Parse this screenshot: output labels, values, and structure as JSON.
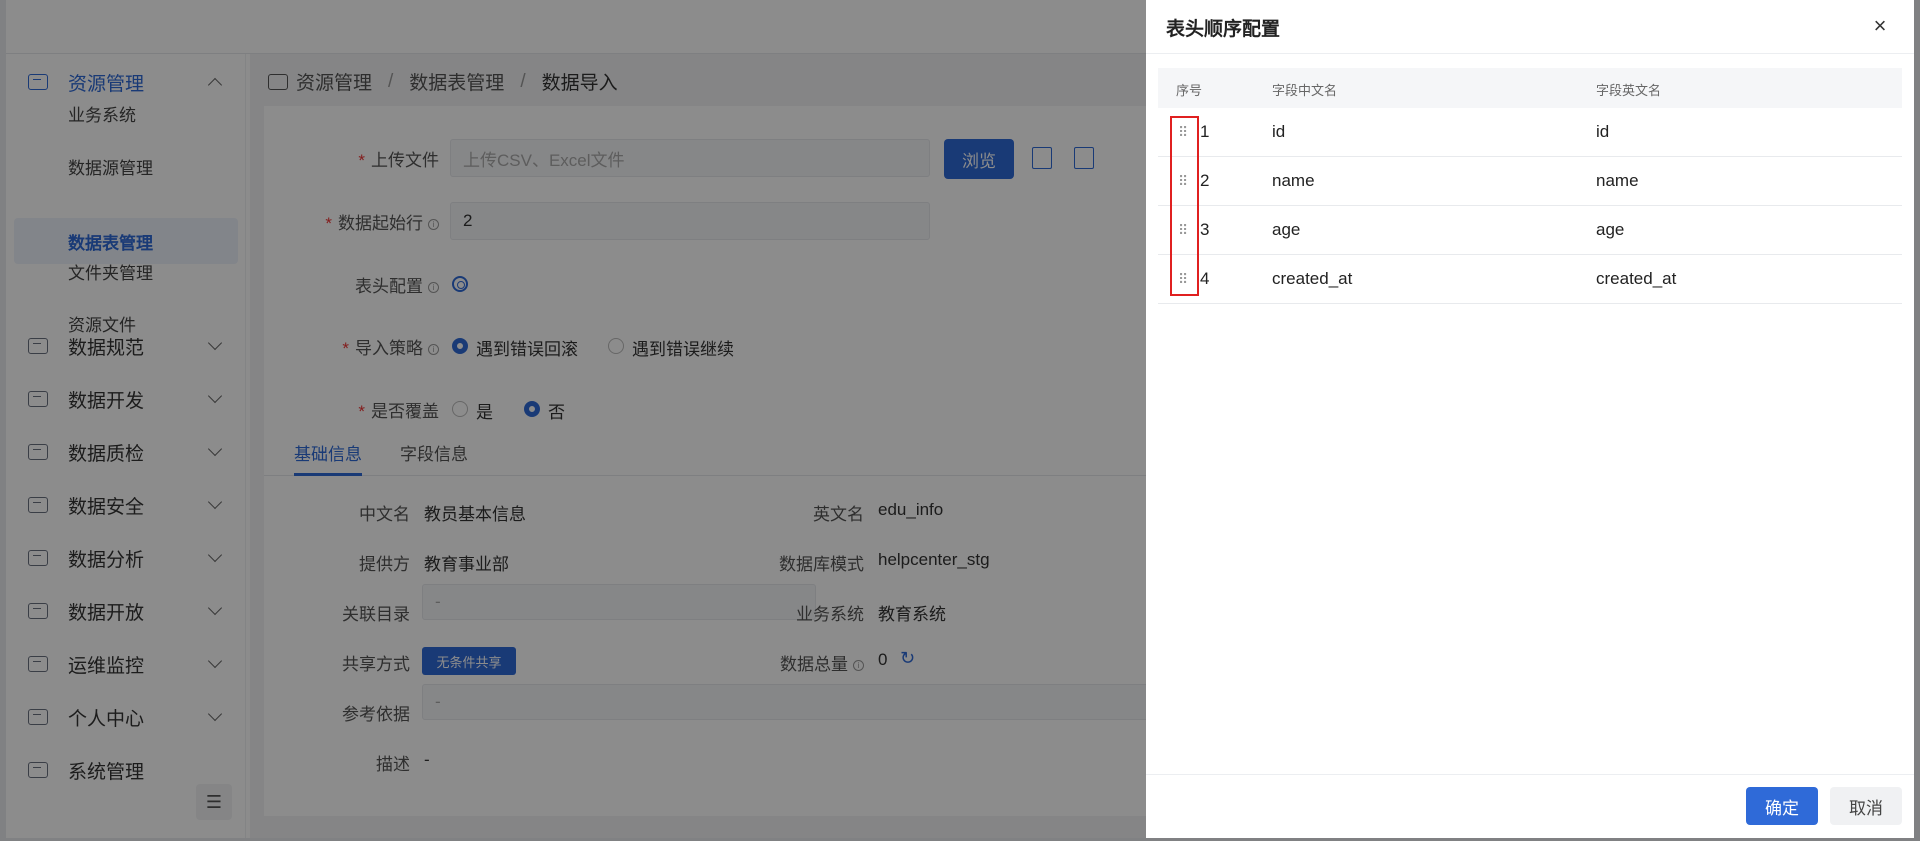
{
  "sidebar": {
    "top": {
      "label": "资源管理",
      "icon": "monitor-icon"
    },
    "sub_items": [
      "业务系统",
      "数据源管理",
      "数据表管理",
      "文件夹管理",
      "资源文件"
    ],
    "active_sub": "数据表管理",
    "menus": [
      {
        "label": "数据规范",
        "icon": "spec-icon"
      },
      {
        "label": "数据开发",
        "icon": "code-icon"
      },
      {
        "label": "数据质检",
        "icon": "quality-icon"
      },
      {
        "label": "数据安全",
        "icon": "security-icon"
      },
      {
        "label": "数据分析",
        "icon": "analysis-icon"
      },
      {
        "label": "数据开放",
        "icon": "open-icon"
      },
      {
        "label": "运维监控",
        "icon": "monitor-chart-icon"
      },
      {
        "label": "个人中心",
        "icon": "user-icon"
      },
      {
        "label": "系统管理",
        "icon": "system-icon"
      }
    ],
    "collapse_icon": "collapse-icon"
  },
  "breadcrumb": {
    "items": [
      "资源管理",
      "数据表管理",
      "数据导入"
    ],
    "separator": "/"
  },
  "form": {
    "upload": {
      "label": "上传文件",
      "placeholder": "上传CSV、Excel文件",
      "browse": "浏览"
    },
    "start_row": {
      "label": "数据起始行",
      "value": "2"
    },
    "header_config": {
      "label": "表头配置"
    },
    "strategy": {
      "label": "导入策略",
      "options": [
        "遇到错误回滚",
        "遇到错误继续"
      ],
      "selected": 0
    },
    "overwrite": {
      "label": "是否覆盖",
      "options": [
        "是",
        "否"
      ],
      "selected": 1
    }
  },
  "tabs": [
    "基础信息",
    "字段信息"
  ],
  "basic_info": {
    "cn_name": {
      "label": "中文名",
      "value": "教员基本信息"
    },
    "en_name": {
      "label": "英文名",
      "value": "edu_info"
    },
    "provider": {
      "label": "提供方",
      "value": "教育事业部"
    },
    "db_mode": {
      "label": "数据库模式",
      "value": "helpcenter_stg"
    },
    "catalog": {
      "label": "关联目录",
      "value": "-"
    },
    "biz_system": {
      "label": "业务系统",
      "value": "教育系统"
    },
    "share": {
      "label": "共享方式",
      "value": "无条件共享"
    },
    "total": {
      "label": "数据总量",
      "value": "0"
    },
    "reference": {
      "label": "参考依据",
      "value": "-"
    },
    "desc": {
      "label": "描述",
      "value": "-"
    }
  },
  "drawer": {
    "title": "表头顺序配置",
    "columns": [
      "序号",
      "字段中文名",
      "字段英文名"
    ],
    "rows": [
      {
        "index": "1",
        "cn": "id",
        "en": "id"
      },
      {
        "index": "2",
        "cn": "name",
        "en": "name"
      },
      {
        "index": "3",
        "cn": "age",
        "en": "age"
      },
      {
        "index": "4",
        "cn": "created_at",
        "en": "created_at"
      }
    ],
    "confirm": "确定",
    "cancel": "取消",
    "drag_glyph": "⠿",
    "close_glyph": "×"
  }
}
